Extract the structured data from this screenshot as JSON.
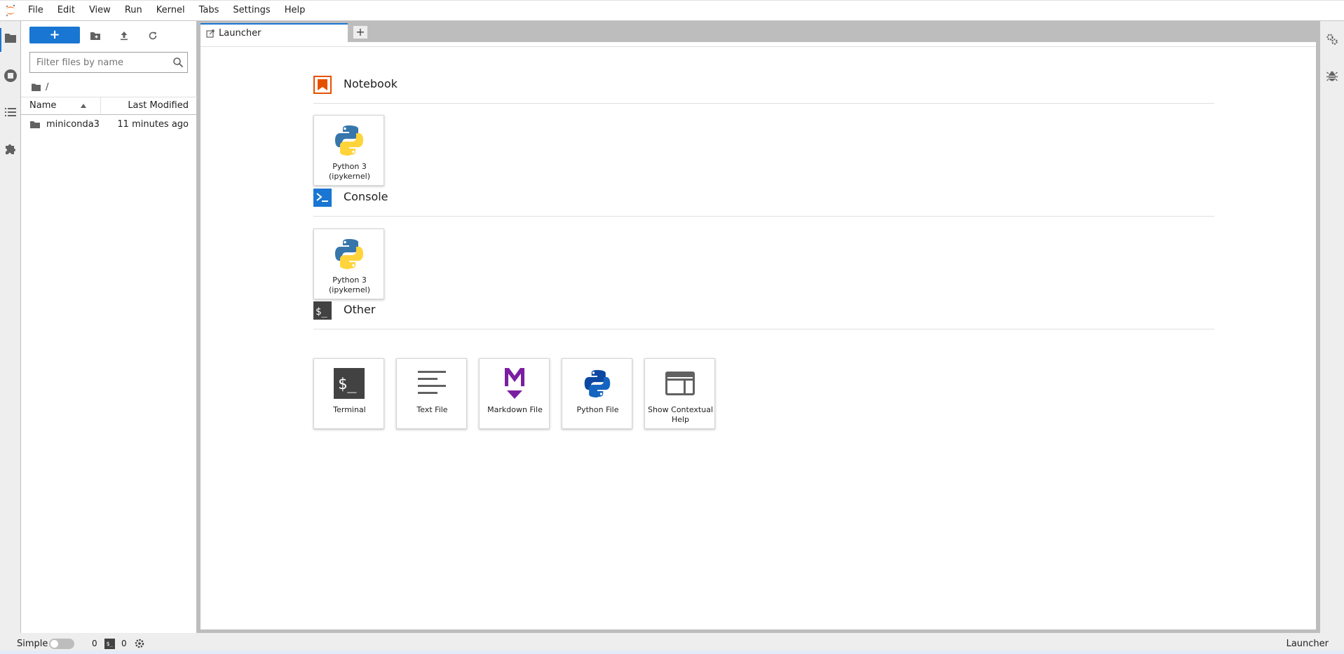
{
  "menu": [
    "File",
    "Edit",
    "View",
    "Run",
    "Kernel",
    "Tabs",
    "Settings",
    "Help"
  ],
  "file_browser": {
    "new_button_label": "+",
    "filter_placeholder": "Filter files by name",
    "breadcrumb": "/",
    "columns": {
      "name": "Name",
      "last_modified": "Last Modified"
    },
    "files": [
      {
        "name": "miniconda3",
        "modified": "11 minutes ago",
        "type": "folder"
      }
    ]
  },
  "tabs": [
    {
      "label": "Launcher",
      "active": true
    }
  ],
  "launcher": {
    "sections": [
      {
        "title": "Notebook",
        "items": [
          {
            "label": "Python 3 (ipykernel)",
            "icon": "python-icon"
          }
        ]
      },
      {
        "title": "Console",
        "items": [
          {
            "label": "Python 3 (ipykernel)",
            "icon": "python-icon"
          }
        ]
      },
      {
        "title": "Other",
        "items": [
          {
            "label": "Terminal",
            "icon": "terminal-icon"
          },
          {
            "label": "Text File",
            "icon": "text-file-icon"
          },
          {
            "label": "Markdown File",
            "icon": "markdown-icon"
          },
          {
            "label": "Python File",
            "icon": "python-file-icon"
          },
          {
            "label": "Show Contextual Help",
            "icon": "contextual-help-icon"
          }
        ]
      }
    ]
  },
  "statusbar": {
    "simple_label": "Simple",
    "kernel_count": "0",
    "terminal_count": "0",
    "current_activity": "Launcher"
  },
  "colors": {
    "accent": "#1976d2",
    "notebook_icon": "#e65100",
    "console_icon": "#1976d2",
    "other_icon": "#424242",
    "markdown": "#7b1fa2"
  }
}
